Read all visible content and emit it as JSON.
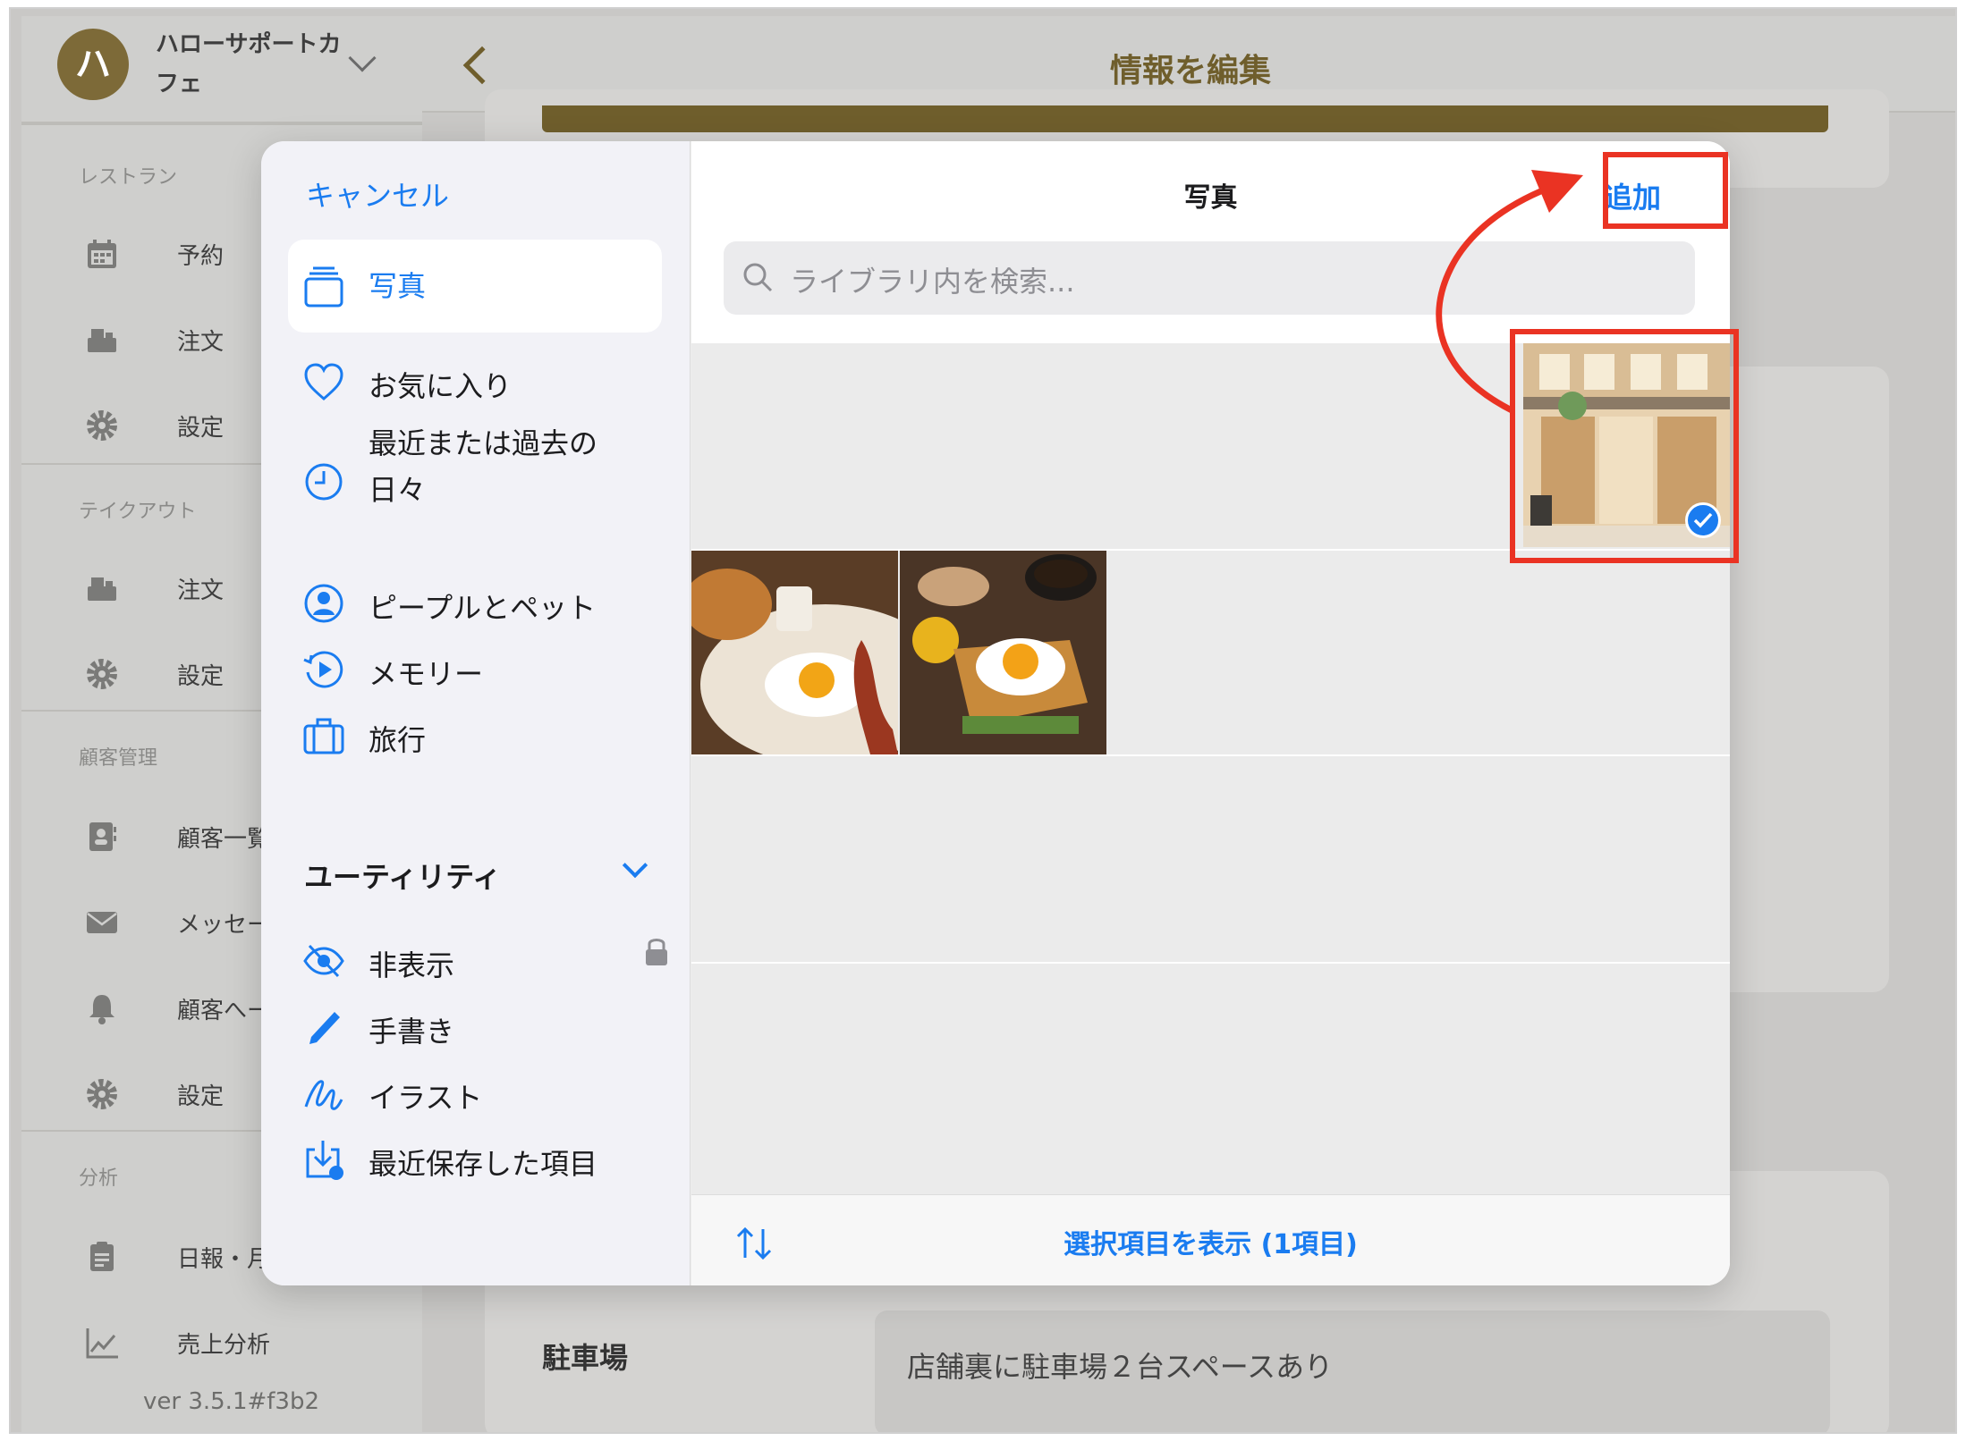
{
  "app": {
    "shop_initial": "ハ",
    "shop_name": "ハローサポートカフェ",
    "page_title": "情報を編集",
    "version": "ver 3.5.1#f3b2",
    "sections": {
      "restaurant": "レストラン",
      "takeout": "テイクアウト",
      "customers": "顧客管理",
      "analytics": "分析"
    },
    "nav": {
      "reservations": "予約",
      "orders": "注文",
      "settings": "設定",
      "takeout_orders": "注文",
      "takeout_settings": "設定",
      "customer_list": "顧客一覧",
      "messages": "メッセー",
      "customer_page": "顧客へー",
      "customer_settings": "設定",
      "daily_report": "日報・月",
      "sales_analysis": "売上分析"
    },
    "parking": {
      "label": "駐車場",
      "value": "店舗裏に駐車場２台スペースあり"
    }
  },
  "picker": {
    "cancel": "キャンセル",
    "title": "写真",
    "add": "追加",
    "search_placeholder": "ライブラリ内を検索...",
    "sidebar": {
      "photos": "写真",
      "favorites": "お気に入り",
      "recent_days": "最近または過去の日々",
      "people_pets": "ピープルとペット",
      "memories": "メモリー",
      "trips": "旅行",
      "utilities": "ユーティリティ",
      "hidden": "非表示",
      "handwriting": "手書き",
      "illustrations": "イラスト",
      "recently_saved": "最近保存した項目"
    },
    "show_selected": "選択項目を表示 (1項目)",
    "selected_count": 1
  },
  "colors": {
    "accent_blue": "#1a7cf0",
    "brand_olive": "#6f5e2c",
    "annotation_red": "#ea3323"
  }
}
